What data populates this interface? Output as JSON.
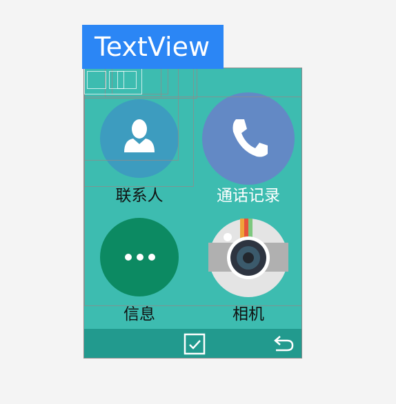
{
  "inspector": {
    "tooltip_text": "TextView"
  },
  "apps": [
    {
      "label": "联系人",
      "icon": "contact-person-icon",
      "color": "#3d9cbf"
    },
    {
      "label": "通话记录",
      "icon": "phone-handset-icon",
      "color": "#6389c5"
    },
    {
      "label": "信息",
      "icon": "message-dots-icon",
      "color": "#0c8a62"
    },
    {
      "label": "相机",
      "icon": "camera-icon",
      "color": "#e4e4e4"
    }
  ],
  "navbar": {
    "icons": [
      "checkbox-icon",
      "back-arrow-icon"
    ]
  },
  "colors": {
    "background": "#3dbcb0",
    "navbar": "#229a8e",
    "tooltip": "#2b86f5"
  }
}
